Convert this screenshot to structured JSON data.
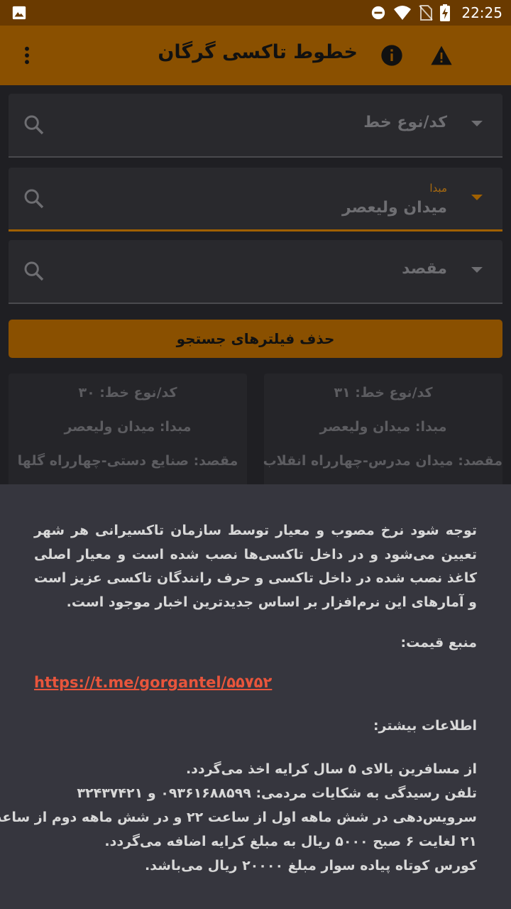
{
  "status_bar": {
    "time": "22:25",
    "icons": [
      "image-icon",
      "dnd-icon",
      "wifi-icon",
      "no-sim-icon",
      "battery-charging-icon"
    ]
  },
  "app_bar": {
    "title": "خطوط تاکسی گرگان",
    "actions": [
      "info-icon",
      "warning-icon",
      "more-vert-icon"
    ]
  },
  "filters": {
    "line_code": {
      "placeholder": "کد/نوع خط"
    },
    "origin": {
      "label": "مبدا",
      "value": "میدان ولیعصر"
    },
    "destination": {
      "placeholder": "مقصد"
    },
    "clear_label": "حذف فیلترهای جستجو"
  },
  "cards": [
    {
      "code": "کد/نوع خط: ۳۱",
      "origin": "مبدا: میدان ولیعصر",
      "destination": "مقصد: میدان مدرس-چهارراه انقلاب"
    },
    {
      "code": "کد/نوع خط: ۳۰",
      "origin": "مبدا: میدان ولیعصر",
      "destination": "مقصد: صنایع دستی-چهارراه گلها"
    }
  ],
  "info_sheet": {
    "notice": "توجه شود نرخ مصوب و معیار توسط سازمان تاکسیرانی هر شهر تعیین می‌شود و در داخل تاکسی‌ها نصب شده است و معیار اصلی کاغذ نصب شده در داخل تاکسی و حرف رانندگان تاکسی عزیز است و آمارهای این نرم‌افزار بر اساس جدیدترین اخبار موجود است.",
    "source_heading": "منبع قیمت:",
    "source_link": "https://t.me/gorgantel/۵۵۷۵۲",
    "more_heading": "اطلاعات بیشتر:",
    "more_lines": [
      "از مسافرین بالای ۵ سال کرایه اخذ می‌گردد.",
      "تلفن رسیدگی به شکایات مردمی: ۰۹۳۶۱۶۸۸۵۹۹ و ۳۲۴۳۷۴۲۱",
      "سرویس‌دهی در شش ماهه اول از ساعت ۲۲ و در شش ماهه دوم از ساعت",
      "۲۱ لغایت ۶ صبح ۵۰۰۰ ریال به مبلغ کرایه اضافه می‌گردد.",
      "کورس کوتاه پیاده سوار مبلغ ۲۰۰۰۰ ریال می‌باشد."
    ]
  },
  "colors": {
    "app_bar": "#8a5000",
    "status_bar": "#6a3a00",
    "accent": "#a06000",
    "link": "#e8553c",
    "sheet_bg": "#36363e"
  }
}
